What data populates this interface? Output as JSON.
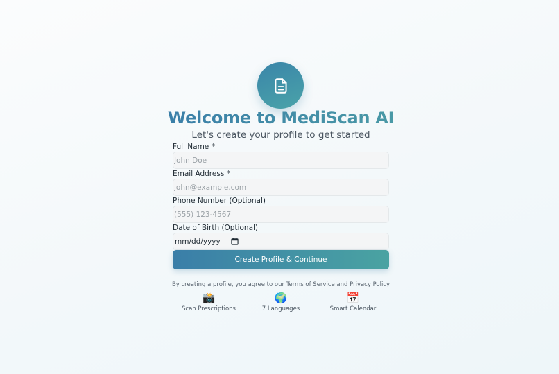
{
  "header": {
    "logo_icon": "document-icon",
    "title": "Welcome to MediScan AI",
    "subtitle": "Let's create your profile to get started"
  },
  "form": {
    "full_name": {
      "label": "Full Name *",
      "placeholder": "John Doe",
      "value": ""
    },
    "email": {
      "label": "Email Address *",
      "placeholder": "john@example.com",
      "value": ""
    },
    "phone": {
      "label": "Phone Number (Optional)",
      "placeholder": "(555) 123-4567",
      "value": ""
    },
    "dob": {
      "label": "Date of Birth (Optional)",
      "display": "mm/dd/yyyy",
      "icon": "calendar-icon"
    },
    "submit_label": "Create Profile & Continue"
  },
  "terms": "By creating a profile, you agree to our Terms of Service and Privacy Policy",
  "features": [
    {
      "icon": "📸",
      "label": "Scan Prescriptions"
    },
    {
      "icon": "🌍",
      "label": "7 Languages"
    },
    {
      "icon": "📅",
      "label": "Smart Calendar"
    }
  ],
  "colors": {
    "accent_start": "#3a7ea8",
    "accent_end": "#4aa3a2",
    "input_bg": "#f4f5f6"
  }
}
